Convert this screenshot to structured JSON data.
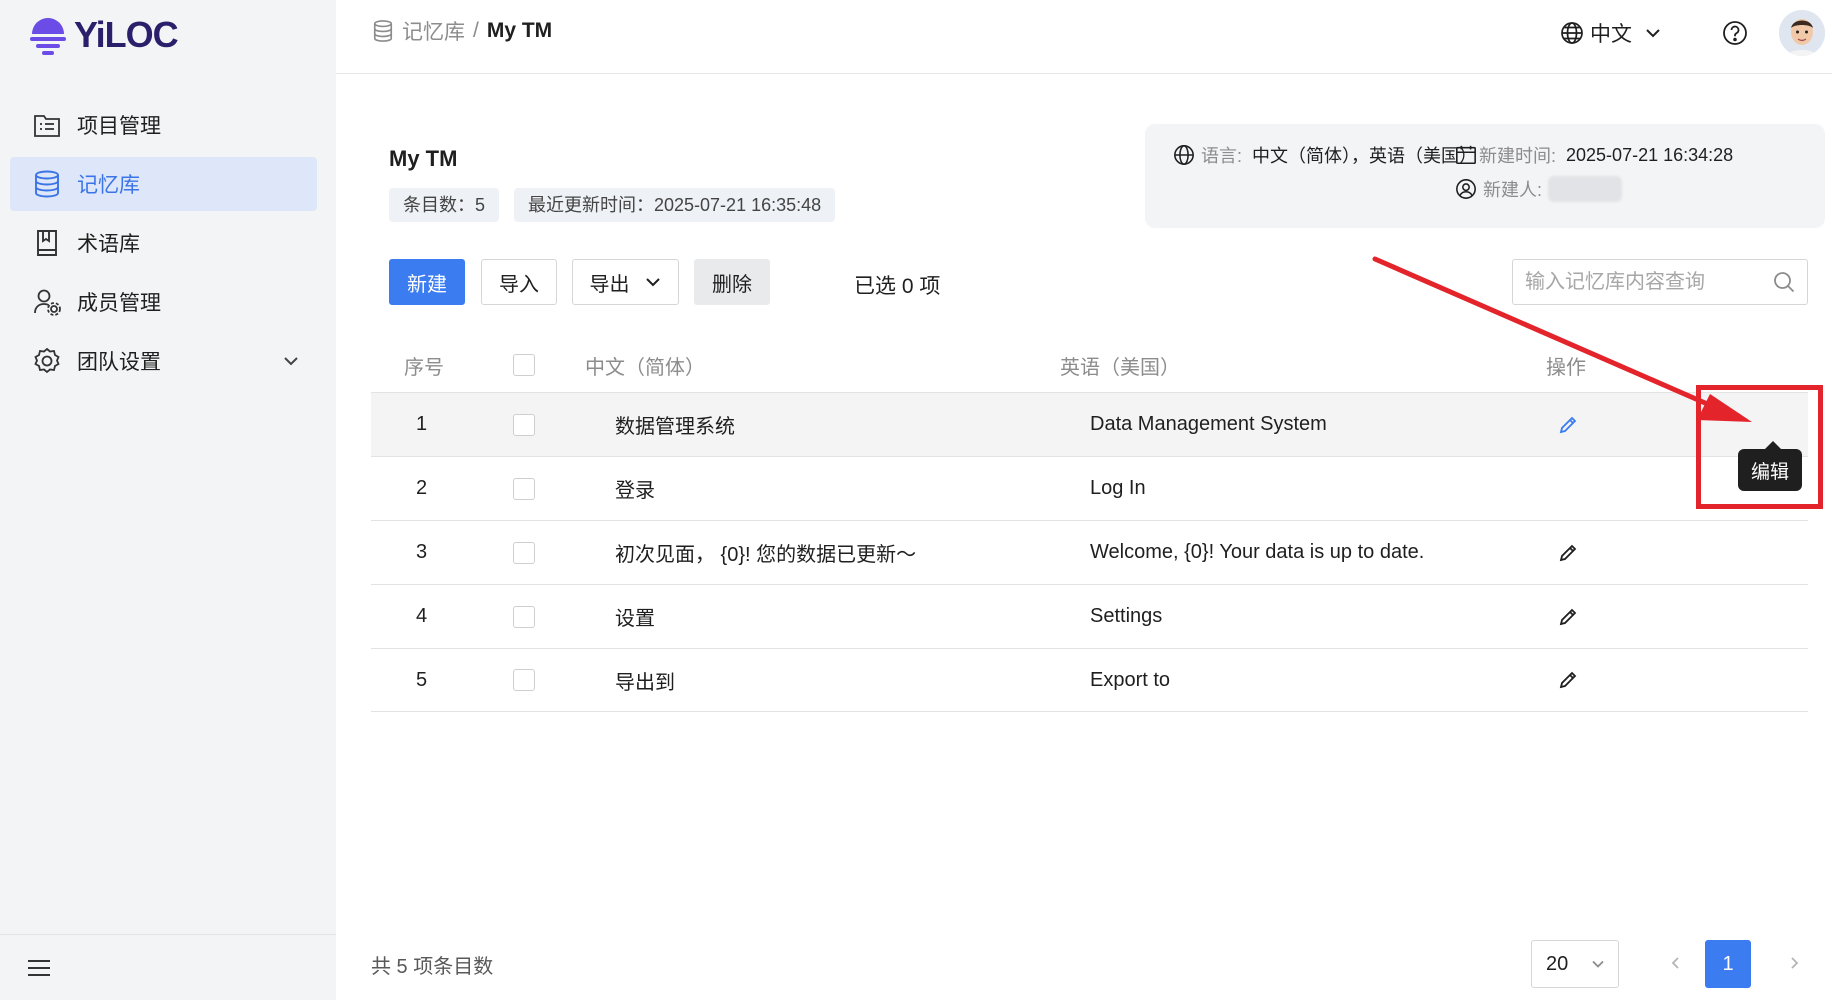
{
  "app": {
    "name": "YiLOC"
  },
  "sidebar": {
    "items": [
      {
        "label": "项目管理",
        "icon": "project-list-icon",
        "active": false
      },
      {
        "label": "记忆库",
        "icon": "database-icon",
        "active": true
      },
      {
        "label": "术语库",
        "icon": "book-icon",
        "active": false
      },
      {
        "label": "成员管理",
        "icon": "user-gear-icon",
        "active": false
      },
      {
        "label": "团队设置",
        "icon": "gear-icon",
        "active": false,
        "expandable": true
      }
    ]
  },
  "header": {
    "breadcrumb": {
      "parent": "记忆库",
      "separator": "/",
      "current": "My TM"
    },
    "language": "中文"
  },
  "tm": {
    "title": "My TM",
    "entry_count": "条目数：5",
    "last_updated": "最近更新时间：2025-07-21 16:35:48",
    "info": {
      "language_label": "语言:",
      "language_value": "中文（简体），英语（美国）",
      "created_label": "新建时间:",
      "created_value": "2025-07-21 16:34:28",
      "creator_label": "新建人:"
    }
  },
  "toolbar": {
    "new_label": "新建",
    "import_label": "导入",
    "export_label": "导出",
    "delete_label": "删除",
    "selected_text": "已选 0 项",
    "search_placeholder": "输入记忆库内容查询"
  },
  "table": {
    "headers": {
      "index": "序号",
      "source": "中文（简体）",
      "target": "英语（美国）",
      "action": "操作"
    },
    "rows": [
      {
        "index": "1",
        "source": "数据管理系统",
        "target": "Data Management System"
      },
      {
        "index": "2",
        "source": "登录",
        "target": "Log In"
      },
      {
        "index": "3",
        "source": "初次见面， {0}! 您的数据已更新～",
        "target": "Welcome, {0}! Your data is up to date."
      },
      {
        "index": "4",
        "source": "设置",
        "target": "Settings"
      },
      {
        "index": "5",
        "source": "导出到",
        "target": "Export to"
      }
    ]
  },
  "tooltip": {
    "edit": "编辑"
  },
  "pagination": {
    "total_text": "共 5 项条目数",
    "page_size": "20",
    "current_page": "1"
  },
  "colors": {
    "primary": "#3b7cf0",
    "active_nav_bg": "#dde7f9",
    "annotation_red": "#e3242b"
  }
}
